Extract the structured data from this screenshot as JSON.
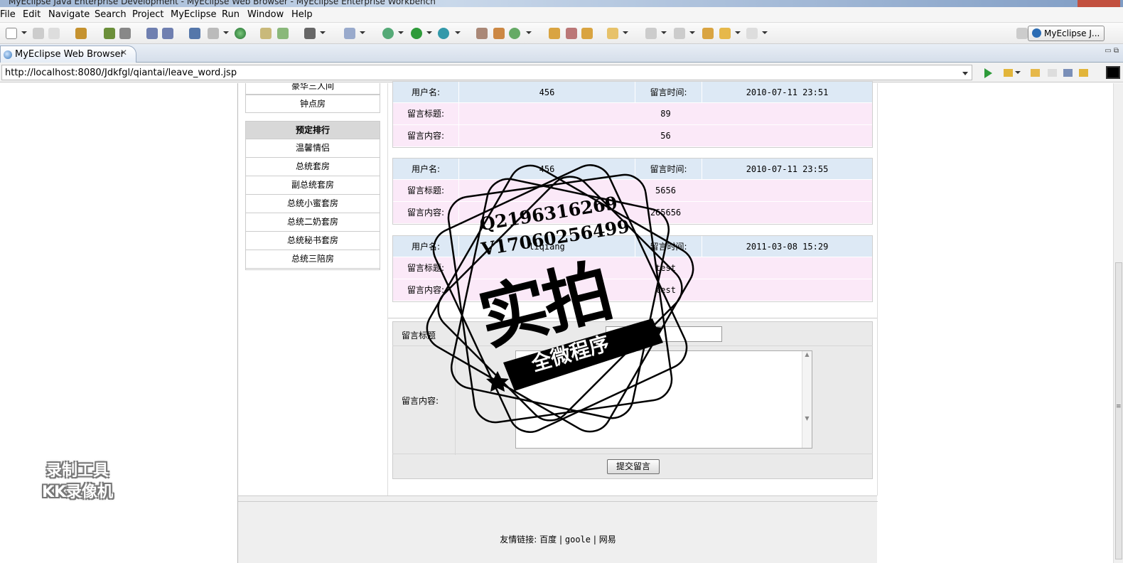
{
  "window": {
    "title": "MyEclipse Java Enterprise Development - MyEclipse Web Browser - MyEclipse Enterprise Workbench"
  },
  "menu": [
    "File",
    "Edit",
    "Navigate",
    "Search",
    "Project",
    "MyEclipse",
    "Run",
    "Window",
    "Help"
  ],
  "perspective": "MyEclipse J...",
  "tab": {
    "label": "MyEclipse Web Browser",
    "close": "✕"
  },
  "url": "http://localhost:8080/Jdkfgl/qiantai/leave_word.jsp",
  "sidebar": {
    "top_items": [
      "豪华三人间",
      "钟点房"
    ],
    "ranking_title": "预定排行",
    "ranking_items": [
      "温馨情侣",
      "总统套房",
      "副总统套房",
      "总统小蜜套房",
      "总统二奶套房",
      "总统秘书套房",
      "总统三陪房"
    ]
  },
  "labels": {
    "user": "用户名:",
    "time": "留言时间:",
    "title": "留言标题:",
    "content": "留言内容:"
  },
  "messages": [
    {
      "user": "456",
      "time": "2010-07-11 23:51",
      "title": "89",
      "content": "56"
    },
    {
      "user": "456",
      "time": "2010-07-11 23:55",
      "title": "5656",
      "content": "265656"
    },
    {
      "user": "liqiang",
      "time": "2011-03-08 15:29",
      "title": "test",
      "content": "test"
    }
  ],
  "form": {
    "title_label": "留言标题",
    "content_label": "留言内容:",
    "title_value": "",
    "submit": "提交留言"
  },
  "footer": {
    "prefix": "友情链接:",
    "links": [
      "百度",
      "goole",
      "网易"
    ],
    "sep": "|"
  },
  "watermark": {
    "line1": "Q2196316269",
    "line2": "V17060256499",
    "big": "实拍",
    "banner": "全微程序",
    "rec1": "录制工具",
    "rec2": "KK录像机"
  }
}
